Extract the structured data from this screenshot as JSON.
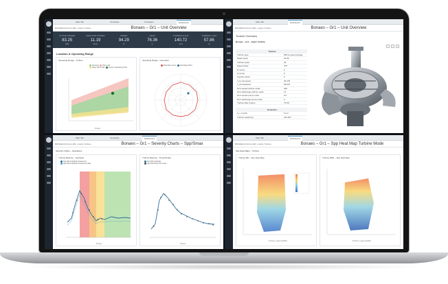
{
  "panel1": {
    "tabs": [
      "Start Tab",
      "Templates",
      "Templates",
      "Dashboard"
    ],
    "crumb": "BONAES-KOLS-G-001 • Hydro Turbine",
    "title": "Bonaes – Gr1 – Unit Overview",
    "kpis": [
      {
        "label": "ACTIVE POWER",
        "value": "83.25",
        "unit": "MW"
      },
      {
        "label": "REACTIVE POWER",
        "value": "11.19",
        "unit": "Mvar"
      },
      {
        "label": "SPEED",
        "value": "94.29",
        "unit": "%"
      },
      {
        "label": "HEAD",
        "value": "76.36",
        "unit": "m"
      },
      {
        "label": "TURBINE FLOW",
        "value": "140.72",
        "unit": "m³/s"
      },
      {
        "label": "TURBINE LOAD",
        "value": "57.86",
        "unit": "%"
      }
    ],
    "section": "Location & Operating Range",
    "card1_title": "Operating Range - Turbine",
    "card1_legend": [
      "Nominal",
      "Part Load",
      "Deep Part Load",
      "Current Operating Point"
    ],
    "card2_title": "Operating Range - Generator",
    "card2_legend": [
      "Boundary curve",
      "Operating Point"
    ],
    "chart_x_label": "Power"
  },
  "panel2": {
    "tabs": [
      "Start Tab",
      "Dashboard"
    ],
    "crumb": "BONAES-KOLS-G-001 • Hydro Turbine",
    "title": "Bonaes – Gr1 – Unit Overview",
    "subtitle": "Turbine Overview",
    "table_caption": "Bonaes – Gr1 – Hydro Turbine",
    "table_header": "Turbine",
    "rows": [
      [
        "Turbine type",
        "IBP pumped storage"
      ],
      [
        "Rated head",
        "24.96"
      ],
      [
        "Turbine head",
        "33"
      ],
      [
        "Speed rated",
        "375"
      ],
      [
        "D runner",
        "0"
      ],
      [
        "Z runner",
        "0"
      ],
      [
        "Z guide vanes",
        "0"
      ],
      [
        "h_fu oat speed",
        "26.278"
      ],
      [
        "h_du baseload",
        "95.676"
      ],
      [
        "Nom speed turbine mode",
        "460"
      ],
      [
        "Nom discharge turbine mode",
        "73"
      ],
      [
        "Nom speed pump mode",
        "0.2"
      ],
      [
        "Nom discharge pump mode",
        "0"
      ],
      [
        "Turbine Max Output",
        "75.68"
      ]
    ],
    "gen_header": "Generator",
    "gen_rows": [
      [
        "S_n in kVA",
        "5.4.2"
      ],
      [
        "Turbine weight kg",
        "162.547"
      ]
    ]
  },
  "panel3": {
    "tabs": [
      "Start Tab",
      "Templates",
      "Dashboard"
    ],
    "crumb": "BONAES-KOLS-G-001 • Hydro Turbine",
    "title": "Bonaes – Gr1 – Severity Charts – Spp/Smax",
    "subtitle": "Severity Charts – Operations",
    "card1_title": "Turbine Bearing – Hydraulic",
    "card1_legend": [
      "Spp DE Amplitude Frequency",
      "Spp DE Amplitude Frequency Heat"
    ],
    "card2_title": "Turbine Bearing – Thrust/Guide",
    "card2_legend": [
      "Spp DE Hydraulic",
      "Spp DE Deep Part Load"
    ],
    "x_label": "Power"
  },
  "panel4": {
    "tabs": [
      "Start Tab",
      "Dashboard"
    ],
    "crumb": "BONAES-KOLS-G-001 • Hydro Turbine",
    "title": "Bonaes – Gr1 – Spp Heat Map Turbine Mode",
    "subtitle": "Spp Heat Maps – Turbine",
    "card1_title": "Turbine DE – Spp Heat Map",
    "card2_title": "Turbine NDE – Spp Heat Map",
    "x_label": "Turbine output [MW]"
  }
}
